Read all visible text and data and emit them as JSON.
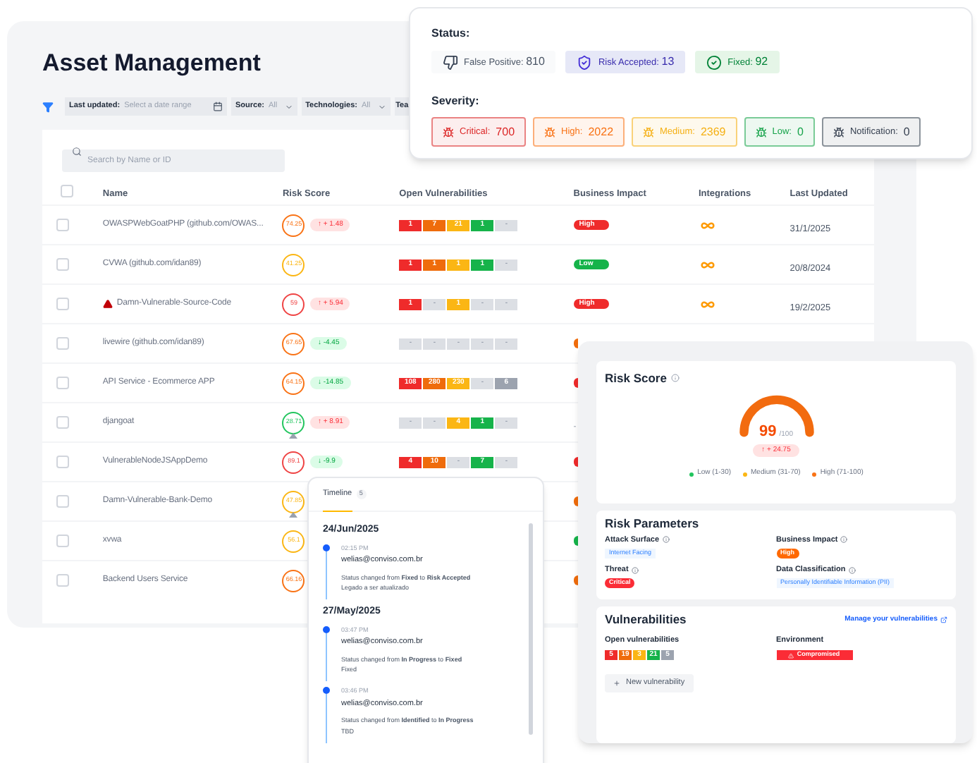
{
  "main": {
    "title": "Asset Management",
    "filters": [
      {
        "kind": "date",
        "label": "Last updated:",
        "placeholder": "Select a date range"
      },
      {
        "kind": "select",
        "label": "Source:",
        "value": "All"
      },
      {
        "kind": "select",
        "label": "Technologies:",
        "value": "All"
      },
      {
        "kind": "cut",
        "label": "Tea"
      }
    ],
    "search": {
      "placeholder": "Search by Name or ID"
    },
    "table": {
      "select_all_checked": false,
      "columns": [
        "Name",
        "Risk Score",
        "Open Vulnerabilities",
        "Business Impact",
        "Integrations",
        "Last Updated"
      ],
      "rows": [
        {
          "checked": false,
          "name": "OWASPWebGoatPHP (github.com/OWAS...",
          "warning": false,
          "score": {
            "text": "74.25",
            "color": "#f97316"
          },
          "marker": false,
          "trend": {
            "text": "↑ + 1.48",
            "kind": "up"
          },
          "vulns": [
            {
              "text": "1",
              "color": "#ef2b2b"
            },
            {
              "text": "7",
              "color": "#ef6c0c"
            },
            {
              "text": "21",
              "color": "#fbb614"
            },
            {
              "text": "1",
              "color": "#16b34a"
            },
            {
              "text": "-",
              "color": "#dcdfe4"
            }
          ],
          "impact": {
            "label": "High",
            "color": "#ef2b2b"
          },
          "integration": true,
          "updated": "31/1/2025"
        },
        {
          "checked": false,
          "name": "CVWA (github.com/idan89)",
          "warning": false,
          "score": {
            "text": "41.25",
            "color": "#fbb614"
          },
          "marker": false,
          "vulns": [
            {
              "text": "1",
              "color": "#ef2b2b"
            },
            {
              "text": "1",
              "color": "#ef6c0c"
            },
            {
              "text": "1",
              "color": "#fbb614"
            },
            {
              "text": "1",
              "color": "#16b34a"
            },
            {
              "text": "-",
              "color": "#dcdfe4"
            }
          ],
          "impact": {
            "label": "Low",
            "color": "#16b34a"
          },
          "integration": true,
          "updated": "20/8/2024"
        },
        {
          "checked": false,
          "name": "Damn-Vulnerable-Source-Code",
          "warning": true,
          "score": {
            "text": "59",
            "color": "#ef4444"
          },
          "marker": false,
          "trend": {
            "text": "↑ + 5.94",
            "kind": "up"
          },
          "vulns": [
            {
              "text": "1",
              "color": "#ef2b2b"
            },
            {
              "text": "-",
              "color": "#dcdfe4"
            },
            {
              "text": "1",
              "color": "#fbb614"
            },
            {
              "text": "-",
              "color": "#dcdfe4"
            },
            {
              "text": "-",
              "color": "#dcdfe4"
            }
          ],
          "impact": {
            "label": "High",
            "color": "#ef2b2b"
          },
          "integration": true,
          "updated": "19/2/2025"
        },
        {
          "checked": false,
          "name": "livewire (github.com/idan89)",
          "warning": false,
          "score": {
            "text": "67.65",
            "color": "#f97316"
          },
          "marker": false,
          "trend": {
            "text": "↓ -4.45",
            "kind": "down"
          },
          "vulns": [
            {
              "text": "-",
              "color": "#dcdfe4"
            },
            {
              "text": "-",
              "color": "#dcdfe4"
            },
            {
              "text": "-",
              "color": "#dcdfe4"
            },
            {
              "text": "-",
              "color": "#dcdfe4"
            },
            {
              "text": "-",
              "color": "#dcdfe4"
            }
          ],
          "impact": {
            "color": "#ef6c0c"
          }
        },
        {
          "checked": false,
          "name": "API Service - Ecommerce APP",
          "warning": false,
          "score": {
            "text": "64.15",
            "color": "#f97316"
          },
          "marker": false,
          "trend": {
            "text": "↓ -14.85",
            "kind": "down"
          },
          "vulns": [
            {
              "text": "108",
              "color": "#ef2b2b"
            },
            {
              "text": "280",
              "color": "#ef6c0c"
            },
            {
              "text": "230",
              "color": "#fbb614"
            },
            {
              "text": "-",
              "color": "#dcdfe4"
            },
            {
              "text": "6",
              "color": "#9ca3af"
            }
          ],
          "impact": {
            "color": "#ef2b2b"
          }
        },
        {
          "checked": false,
          "name": "djangoat",
          "warning": false,
          "score": {
            "text": "28.71",
            "color": "#22c55e"
          },
          "marker": true,
          "trend": {
            "text": "↑ + 8.91",
            "kind": "up"
          },
          "vulns": [
            {
              "text": "-",
              "color": "#dcdfe4"
            },
            {
              "text": "-",
              "color": "#dcdfe4"
            },
            {
              "text": "4",
              "color": "#fbb614"
            },
            {
              "text": "1",
              "color": "#16b34a"
            },
            {
              "text": "-",
              "color": "#dcdfe4"
            }
          ],
          "impact": {
            "label": "-"
          }
        },
        {
          "checked": false,
          "name": "VulnerableNodeJSAppDemo",
          "warning": false,
          "score": {
            "text": "89.1",
            "color": "#ef4444"
          },
          "marker": false,
          "trend": {
            "text": "↓ -9.9",
            "kind": "down"
          },
          "vulns": [
            {
              "text": "4",
              "color": "#ef2b2b"
            },
            {
              "text": "10",
              "color": "#ef6c0c"
            },
            {
              "text": "-",
              "color": "#dcdfe4"
            },
            {
              "text": "7",
              "color": "#16b34a"
            },
            {
              "text": "-",
              "color": "#dcdfe4"
            }
          ],
          "impact": {
            "color": "#ef2b2b"
          }
        },
        {
          "checked": false,
          "name": "Damn-Vulnerable-Bank-Demo",
          "warning": false,
          "score": {
            "text": "47.85",
            "color": "#fbb614"
          },
          "marker": true,
          "impact": {
            "color": "#ef6c0c"
          }
        },
        {
          "checked": false,
          "name": "xvwa",
          "warning": false,
          "score": {
            "text": "56.1",
            "color": "#fbb614"
          },
          "marker": false,
          "impact": {
            "color": "#16b34a"
          }
        },
        {
          "checked": false,
          "name": "Backend Users Service",
          "warning": false,
          "score": {
            "text": "66.16",
            "color": "#f97316"
          },
          "marker": false,
          "impact": {
            "color": "#ef6c0c"
          }
        }
      ]
    }
  },
  "status_card": {
    "status_title": "Status:",
    "statuses": [
      {
        "kind": "false_positive",
        "label": "False Positive:",
        "count": "810"
      },
      {
        "kind": "risk_accepted",
        "label": "Risk Accepted:",
        "count": "13"
      },
      {
        "kind": "fixed",
        "label": "Fixed:",
        "count": "92"
      }
    ],
    "severity_title": "Severity:",
    "severities": [
      {
        "label": "Critical:",
        "count": "700",
        "color": "#dc2626"
      },
      {
        "label": "High:",
        "count": "2022",
        "color": "#f97316"
      },
      {
        "label": "Medium:",
        "count": "2369",
        "color": "#f5b014"
      },
      {
        "label": "Low:",
        "count": "0",
        "color": "#16a34a"
      },
      {
        "label": "Notification:",
        "count": "0",
        "color": "#374151"
      }
    ]
  },
  "risk_card": {
    "title": "Risk Score",
    "gauge": {
      "value": "99",
      "max": "/100"
    },
    "trend": "↑ + 24.75",
    "legend": [
      {
        "label": "Low (1-30)",
        "color": "#22c55e"
      },
      {
        "label": "Medium (31-70)",
        "color": "#fbb614"
      },
      {
        "label": "High (71-100)",
        "color": "#f97316"
      }
    ],
    "params_title": "Risk Parameters",
    "params": [
      {
        "label": "Attack Surface",
        "value": "Internet Facing",
        "kind": "tag"
      },
      {
        "label": "Business Impact",
        "value": "High",
        "kind": "orange"
      },
      {
        "label": "Threat",
        "value": "Critical",
        "kind": "red"
      },
      {
        "label": "Data Classification",
        "value": "Personally Identifiable Information (PII)",
        "kind": "tag"
      }
    ],
    "vuln_title": "Vulnerabilities",
    "manage_link": "Manage your vulnerabilities",
    "open_title": "Open vulnerabilities",
    "open": [
      {
        "text": "5",
        "color": "#ef2b2b"
      },
      {
        "text": "19",
        "color": "#ef6c0c"
      },
      {
        "text": "3",
        "color": "#fbb614"
      },
      {
        "text": "21",
        "color": "#16b34a"
      },
      {
        "text": "5",
        "color": "#9ca3af"
      }
    ],
    "env_title": "Environment",
    "environment": "Compromised",
    "new_button": "New vulnerability"
  },
  "timeline": {
    "tab": "Timeline",
    "count": "5",
    "groups": [
      {
        "date": "24/Jun/2025",
        "entries": [
          {
            "time": "02:15 PM",
            "user": "welias@conviso.com.br",
            "change": "Status changed from **Fixed** to **Risk Accepted**",
            "note": "Legado a ser atualizado"
          }
        ]
      },
      {
        "date": "27/May/2025",
        "entries": [
          {
            "time": "03:47 PM",
            "user": "welias@conviso.com.br",
            "change": "Status changed from **In Progress** to **Fixed**",
            "note": "Fixed"
          },
          {
            "time": "03:46 PM",
            "user": "welias@conviso.com.br",
            "change": "Status changed from **Identified** to **In Progress**",
            "note": "TBD"
          }
        ]
      }
    ]
  }
}
